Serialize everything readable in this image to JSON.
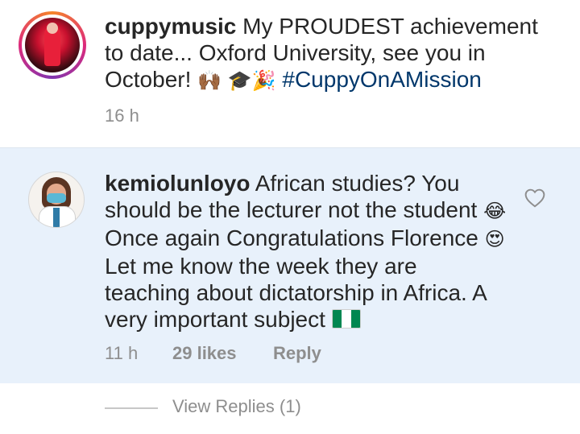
{
  "post": {
    "username": "cuppymusic",
    "caption_before_emoji": "My PROUDEST achievement to date... Oxford University, see you in October!",
    "emoji_raised_hands": "🙌🏾",
    "emoji_grad": "🎓🎉",
    "hashtag": "#CuppyOnAMission",
    "time": "16 h"
  },
  "comment": {
    "username": "kemiolunloyo",
    "line1": "African studies? You should be the lecturer not the student",
    "emoji_laugh": "😂",
    "line2": "Once again Congratulations Florence",
    "emoji_hearts": "😍",
    "line3": "Let me know the week they are teaching about dictatorship in Africa. A very important subject",
    "flag_icon": "nigeria-flag-icon",
    "time": "11 h",
    "likes": "29 likes",
    "reply_label": "Reply"
  },
  "footer": {
    "view_replies": "View Replies (1)"
  },
  "colors": {
    "comment_bg": "#e8f1fb",
    "hashtag": "#00376b",
    "meta": "#8e8e8e"
  }
}
